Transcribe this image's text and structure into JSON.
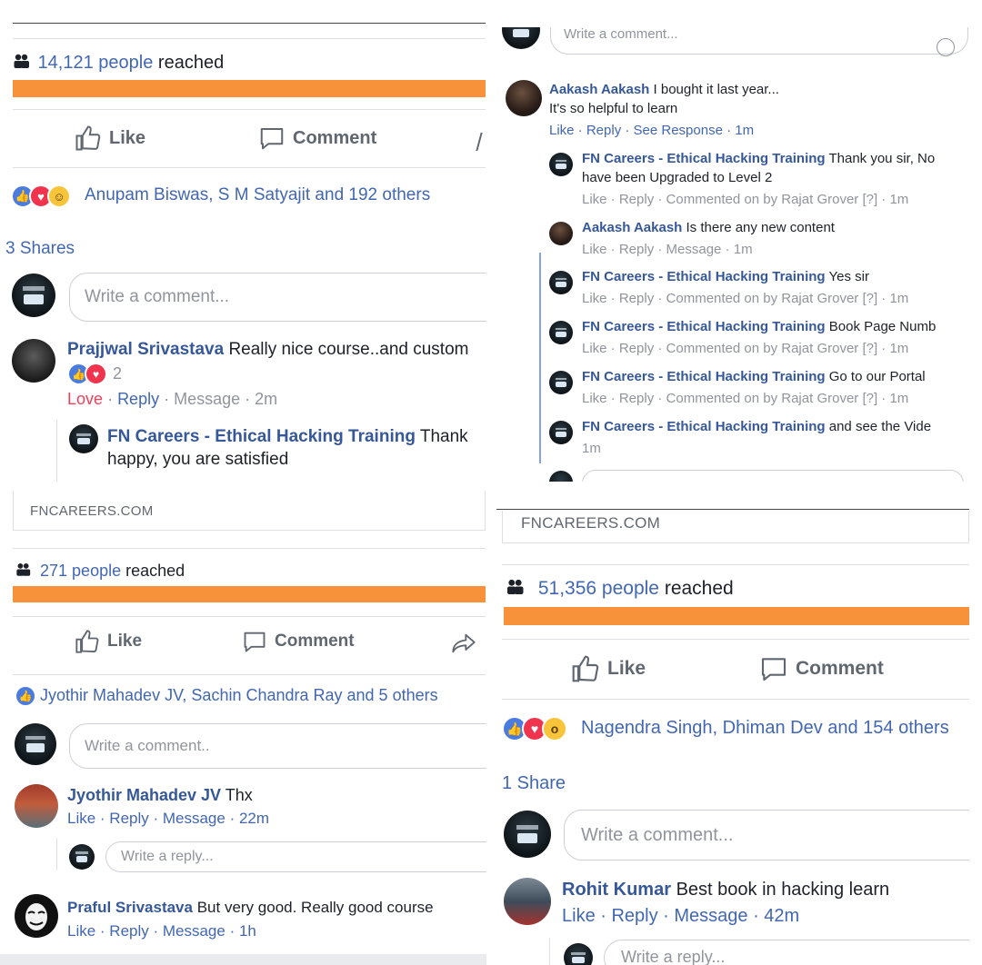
{
  "p1": {
    "reach_num": "14,121 people",
    "reach_word": "reached",
    "like": "Like",
    "comment": "Comment",
    "reactors": "Anupam Biswas, S M Satyajit and 192 others",
    "shares": "3 Shares",
    "write_comment": "Write a comment...",
    "c1_name": "Prajjwal Srivastava",
    "c1_text": "Really nice course..and custom",
    "c1_count": "2",
    "c1_love": "Love",
    "c1_reply": "Reply",
    "c1_message": "Message",
    "c1_time": "2m",
    "c2_name": "FN Careers - Ethical Hacking Training",
    "c2_text1": "Thank",
    "c2_text2": "happy, you are satisfied"
  },
  "p2": {
    "write_comment": "Write a comment...",
    "c1_name": "Aakash Aakash",
    "c1_text1": "I bought it last year...",
    "c1_text2": "It's so helpful to learn",
    "c1_actions": "Like · Reply · See Response · 1m",
    "replies": [
      {
        "name": "FN Careers - Ethical Hacking Training",
        "text": "Thank you sir, No",
        "text2": "have been Upgraded to Level 2",
        "meta": "Like · Reply · Commented on by Rajat Grover [?] · 1m"
      },
      {
        "name": "Aakash Aakash",
        "text": "Is there any new content",
        "text2": "",
        "meta": "Like · Reply · Message · 1m"
      },
      {
        "name": "FN Careers - Ethical Hacking Training",
        "text": "Yes sir",
        "text2": "",
        "meta": "Like · Reply · Commented on by Rajat Grover [?] · 1m"
      },
      {
        "name": "FN Careers - Ethical Hacking Training",
        "text": "Book Page Numb",
        "text2": "",
        "meta": "Like · Reply · Commented on by Rajat Grover [?] · 1m"
      },
      {
        "name": "FN Careers - Ethical Hacking Training",
        "text": "Go to our Portal",
        "text2": "",
        "meta": "Like · Reply · Commented on by Rajat Grover [?] · 1m"
      },
      {
        "name": "FN Careers - Ethical Hacking Training",
        "text": "and see the Vide",
        "text2": "",
        "meta": "1m"
      }
    ]
  },
  "p3": {
    "domain": "FNCAREERS.COM",
    "reach_num": "271 people",
    "reach_word": "reached",
    "like": "Like",
    "comment": "Comment",
    "reactors": "Jyothir Mahadev JV, Sachin Chandra Ray and 5 others",
    "write_comment": "Write a comment..",
    "c1_name": "Jyothir Mahadev JV",
    "c1_text": "Thx",
    "c1_actions": "Like · Reply · Message · 22m",
    "write_reply": "Write a reply...",
    "c2_name": "Praful Srivastava",
    "c2_text": "But very good. Really good course",
    "c2_actions": "Like · Reply · Message · 1h"
  },
  "p4": {
    "domain": "FNCAREERS.COM",
    "reach_num": "51,356 people",
    "reach_word": "reached",
    "like": "Like",
    "comment": "Comment",
    "reactors": "Nagendra Singh, Dhiman Dev and 154 others",
    "shares": "1 Share",
    "write_comment": "Write a comment...",
    "c1_name": "Rohit Kumar",
    "c1_text": "Best book in hacking learn",
    "c1_actions": "Like · Reply · Message · 42m",
    "write_reply": "Write a reply..."
  }
}
